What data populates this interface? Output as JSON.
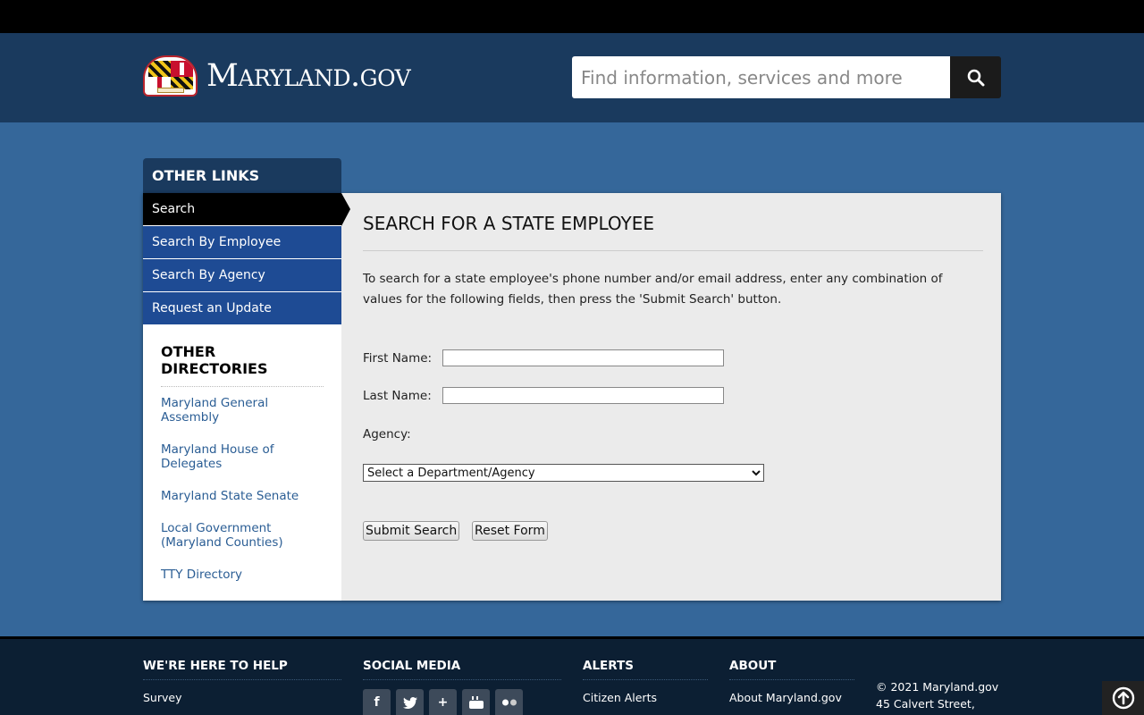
{
  "header": {
    "logo_text": "Maryland.gov",
    "search_placeholder": "Find information, services and more"
  },
  "sidebar": {
    "heading": "OTHER LINKS",
    "items": [
      {
        "label": "Search",
        "active": true
      },
      {
        "label": "Search By Employee"
      },
      {
        "label": "Search By Agency"
      },
      {
        "label": "Request an Update"
      }
    ],
    "directories_title": "OTHER DIRECTORIES",
    "directories": [
      "Maryland General Assembly",
      "Maryland House of Delegates",
      "Maryland State Senate",
      "Local Government (Maryland Counties)",
      "TTY Directory"
    ]
  },
  "main": {
    "title": "SEARCH FOR A STATE EMPLOYEE",
    "intro": "To search for a state employee's phone number and/or email address, enter any combination of values for the following fields, then press the 'Submit Search' button.",
    "first_name_label": "First Name:",
    "first_name_value": "",
    "last_name_label": "Last Name:",
    "last_name_value": "",
    "agency_label": "Agency:",
    "agency_selected": "Select a Department/Agency",
    "submit_label": "Submit Search",
    "reset_label": "Reset Form"
  },
  "footer": {
    "help_title": "WE'RE HERE TO HELP",
    "help_link": "Survey",
    "social_title": "SOCIAL MEDIA",
    "social_icons": [
      "facebook-icon",
      "twitter-icon",
      "google-plus-icon",
      "youtube-icon",
      "flickr-icon"
    ],
    "alerts_title": "ALERTS",
    "alerts_link": "Citizen Alerts",
    "about_title": "ABOUT",
    "about_link": "About Maryland.gov",
    "copyright": "© 2021 Maryland.gov",
    "address_line": "45 Calvert Street,"
  },
  "colors": {
    "header_bg": "#1a3a5e",
    "page_bg": "#35679a",
    "nav_bg": "#1e4b94",
    "link": "#2a5d94",
    "footer_bg": "#0c1f33"
  }
}
